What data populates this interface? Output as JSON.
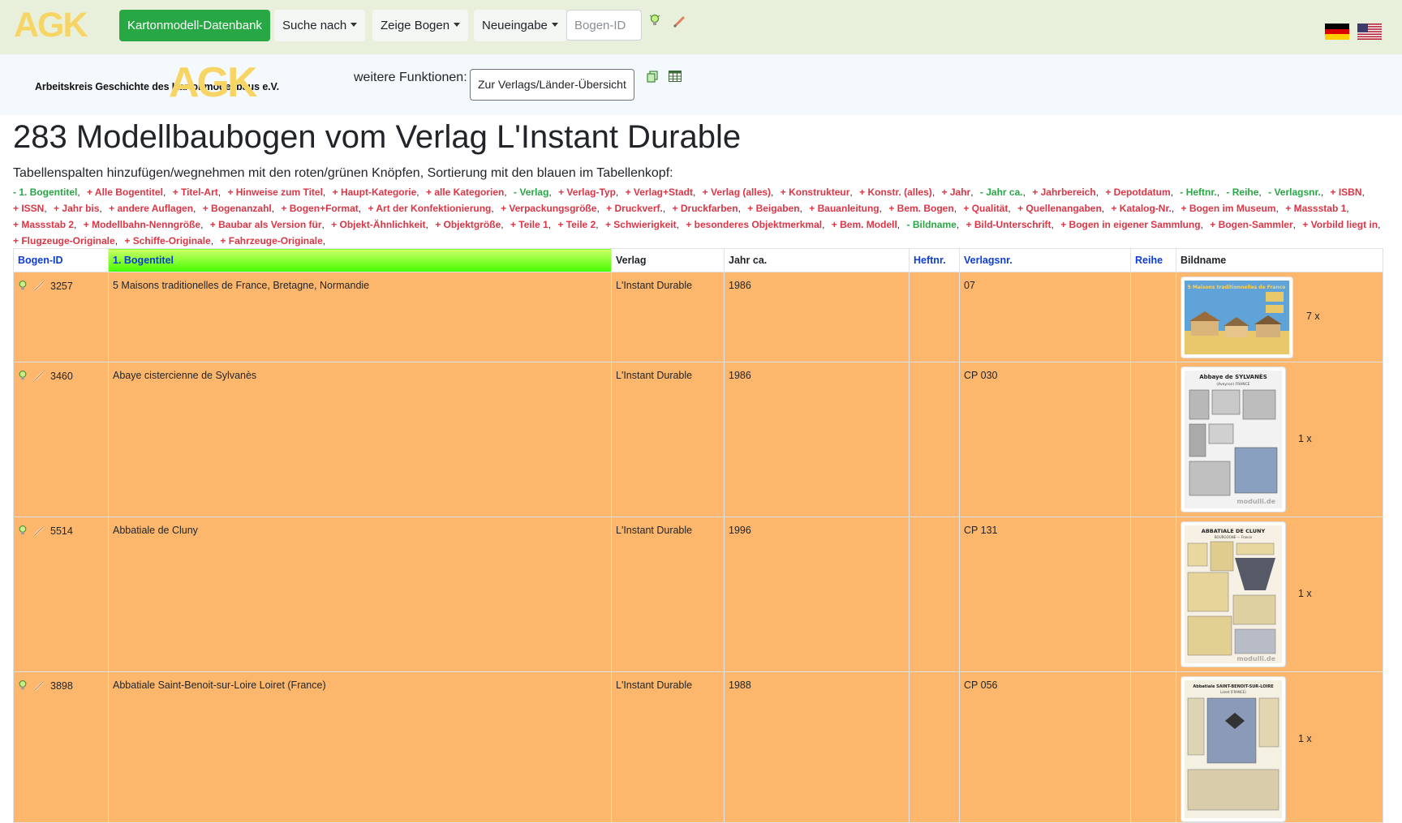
{
  "navbar": {
    "logo": "AGK",
    "db_button": "Kartonmodell-Datenbank",
    "search_menu": "Suche nach",
    "show_menu": "Zeige Bogen",
    "new_menu": "Neueingabe",
    "id_input_placeholder": "Bogen-ID",
    "flags": [
      "german-flag",
      "us-flag"
    ]
  },
  "subheader": {
    "logo_text": "Arbeitskreis Geschichte des Kartonmodellbaus e.V.",
    "logo_agk": "AGK",
    "further_label": "weitere Funktionen:",
    "further_button": "Zur Verlags/Länder-Übersicht"
  },
  "page": {
    "title": "283 Modellbaubogen vom Verlag L'Instant Durable",
    "instructions": "Tabellenspalten hinzufügen/wegnehmen mit den roten/grünen Knöpfen, Sortierung mit den blauen im Tabellenkopf:"
  },
  "column_toggles": [
    {
      "label": "- 1. Bogentitel",
      "state": "on"
    },
    {
      "label": "+ Alle Bogentitel",
      "state": "off"
    },
    {
      "label": "+ Titel-Art",
      "state": "off"
    },
    {
      "label": "+ Hinweise zum Titel",
      "state": "off"
    },
    {
      "label": "+ Haupt-Kategorie",
      "state": "off"
    },
    {
      "label": "+ alle Kategorien",
      "state": "off"
    },
    {
      "label": "- Verlag",
      "state": "on"
    },
    {
      "label": "+ Verlag-Typ",
      "state": "off"
    },
    {
      "label": "+ Verlag+Stadt",
      "state": "off"
    },
    {
      "label": "+ Verlag (alles)",
      "state": "off"
    },
    {
      "label": "+ Konstrukteur",
      "state": "off"
    },
    {
      "label": "+ Konstr. (alles)",
      "state": "off"
    },
    {
      "label": "+ Jahr",
      "state": "off"
    },
    {
      "label": "- Jahr ca.",
      "state": "on"
    },
    {
      "label": "+ Jahrbereich",
      "state": "off"
    },
    {
      "label": "+ Depotdatum",
      "state": "off"
    },
    {
      "label": "- Heftnr.",
      "state": "on"
    },
    {
      "label": "- Reihe",
      "state": "on"
    },
    {
      "label": "- Verlagsnr.",
      "state": "on"
    },
    {
      "label": "+ ISBN",
      "state": "off"
    },
    {
      "label": "+ ISSN",
      "state": "off"
    },
    {
      "label": "+ Jahr bis",
      "state": "off"
    },
    {
      "label": "+ andere Auflagen",
      "state": "off"
    },
    {
      "label": "+ Bogenanzahl",
      "state": "off"
    },
    {
      "label": "+ Bogen+Format",
      "state": "off"
    },
    {
      "label": "+ Art der Konfektionierung",
      "state": "off"
    },
    {
      "label": "+ Verpackungsgröße",
      "state": "off"
    },
    {
      "label": "+ Druckverf.",
      "state": "off"
    },
    {
      "label": "+ Druckfarben",
      "state": "off"
    },
    {
      "label": "+ Beigaben",
      "state": "off"
    },
    {
      "label": "+ Bauanleitung",
      "state": "off"
    },
    {
      "label": "+ Bem. Bogen",
      "state": "off"
    },
    {
      "label": "+ Qualität",
      "state": "off"
    },
    {
      "label": "+ Quellenangaben",
      "state": "off"
    },
    {
      "label": "+ Katalog-Nr.",
      "state": "off"
    },
    {
      "label": "+ Bogen im Museum",
      "state": "off"
    },
    {
      "label": "+ Massstab 1",
      "state": "off"
    },
    {
      "label": "+ Massstab 2",
      "state": "off"
    },
    {
      "label": "+ Modellbahn-Nenngröße",
      "state": "off"
    },
    {
      "label": "+ Baubar als Version für",
      "state": "off"
    },
    {
      "label": "+ Objekt-Ähnlichkeit",
      "state": "off"
    },
    {
      "label": "+ Objektgröße",
      "state": "off"
    },
    {
      "label": "+ Teile 1",
      "state": "off"
    },
    {
      "label": "+ Teile 2",
      "state": "off"
    },
    {
      "label": "+ Schwierigkeit",
      "state": "off"
    },
    {
      "label": "+ besonderes Objektmerkmal",
      "state": "off"
    },
    {
      "label": "+ Bem. Modell",
      "state": "off"
    },
    {
      "label": "- Bildname",
      "state": "on"
    },
    {
      "label": "+ Bild-Unterschrift",
      "state": "off"
    },
    {
      "label": "+ Bogen in eigener Sammlung",
      "state": "off"
    },
    {
      "label": "+ Bogen-Sammler",
      "state": "off"
    },
    {
      "label": "+ Vorbild liegt in",
      "state": "off"
    },
    {
      "label": "+ Flugzeuge-Originale",
      "state": "off"
    },
    {
      "label": "+ Schiffe-Originale",
      "state": "off"
    },
    {
      "label": "+ Fahrzeuge-Originale",
      "state": "off"
    }
  ],
  "table": {
    "headers": [
      "Bogen-ID",
      "1. Bogentitel",
      "Verlag",
      "Jahr ca.",
      "Heftnr.",
      "Verlagsnr.",
      "Reihe",
      "Bildname"
    ],
    "rows": [
      {
        "id": "3257",
        "title": "5 Maisons traditionelles de France, Bretagne, Normandie",
        "publisher": "L'Instant Durable",
        "year": "1986",
        "issue": "",
        "pubno": "07",
        "series": "",
        "count": "7 x",
        "thumb_caption": "5 Maisons traditionnelles de France"
      },
      {
        "id": "3460",
        "title": "Abaye cistercienne de Sylvanès",
        "publisher": "L'Instant Durable",
        "year": "1986",
        "issue": "",
        "pubno": "CP 030",
        "series": "",
        "count": "1 x",
        "thumb_caption": "Abbaye de SYLVANÈS",
        "thumb_sub": "(Aveyron) FRANCE",
        "watermark": "modulli.de"
      },
      {
        "id": "5514",
        "title": "Abbatiale de Cluny",
        "publisher": "L'Instant Durable",
        "year": "1996",
        "issue": "",
        "pubno": "CP 131",
        "series": "",
        "count": "1 x",
        "thumb_caption": "ABBATIALE DE CLUNY",
        "thumb_sub": "BOURGOGNE — France",
        "watermark": "modulli.de"
      },
      {
        "id": "3898",
        "title": "Abbatiale Saint-Benoit-sur-Loire Loiret (France)",
        "publisher": "L'Instant Durable",
        "year": "1988",
        "issue": "",
        "pubno": "CP 056",
        "series": "",
        "count": "1 x",
        "thumb_caption": "Abbatiale SAINT-BENOIT-SUR-LOIRE",
        "thumb_sub": "Loiret (FRANCE)"
      }
    ]
  }
}
